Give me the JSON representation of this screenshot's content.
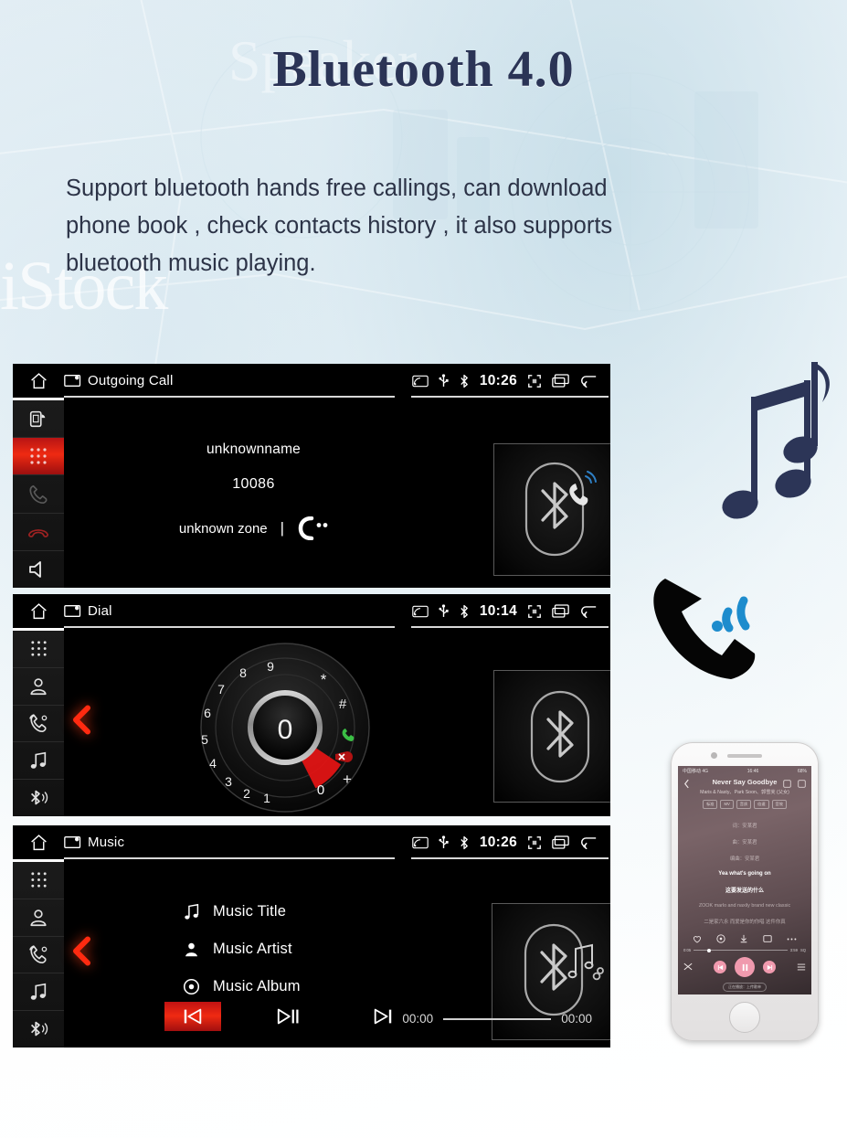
{
  "header": {
    "title": "Bluetooth 4.0",
    "subtitle_lines": [
      "Support bluetooth hands free callings, can download",
      "phone book , check contacts history , it also supports",
      "bluetooth music playing."
    ]
  },
  "background": {
    "watermark": "iStock",
    "watermark_2": "Speaker",
    "accent_blue": "#2b3456",
    "signal_blue": "#1b8fd0",
    "page_bg": "#f2f8fb"
  },
  "screens": [
    {
      "id": "outgoing-call",
      "statusbar": {
        "home_icon": "home-icon",
        "app_icon": "screen-cast-icon",
        "title": "Outgoing Call",
        "status_icons": [
          "cast-icon",
          "usb-icon",
          "bluetooth-icon"
        ],
        "time": "10:26",
        "nav_icons": [
          "fullscreen-icon",
          "recents-icon",
          "back-icon"
        ]
      },
      "sidebar": [
        {
          "name": "phone-signal-icon",
          "active": false
        },
        {
          "name": "keypad-icon",
          "active": true
        },
        {
          "name": "call-icon",
          "active": false
        },
        {
          "name": "hangup-icon",
          "active": false
        },
        {
          "name": "speaker-icon",
          "active": false
        }
      ],
      "call": {
        "name": "unknownname",
        "number": "10086",
        "zone": "unknown zone",
        "divider": "|",
        "status_icon": "calling-icon"
      },
      "art_icon": "bluetooth-call-icon"
    },
    {
      "id": "dial",
      "statusbar": {
        "home_icon": "home-icon",
        "app_icon": "screen-cast-icon",
        "title": "Dial",
        "status_icons": [
          "cast-icon",
          "usb-icon",
          "bluetooth-icon"
        ],
        "time": "10:14",
        "nav_icons": [
          "fullscreen-icon",
          "recents-icon",
          "back-icon"
        ]
      },
      "sidebar": [
        {
          "name": "keypad-icon",
          "active": false
        },
        {
          "name": "contacts-icon",
          "active": false
        },
        {
          "name": "call-history-icon",
          "active": false
        },
        {
          "name": "music-icon",
          "active": false
        },
        {
          "name": "bluetooth-icon",
          "active": false
        }
      ],
      "dialpad": {
        "center_display": "0",
        "outer_keys": [
          "1",
          "2",
          "3",
          "4",
          "5",
          "6",
          "7",
          "8",
          "9",
          "*",
          "#"
        ],
        "highlighted_key": "0",
        "extra_keys": [
          "+"
        ],
        "call_button": "green-call-icon",
        "delete_button": "red-delete-icon"
      },
      "art_icon": "bluetooth-icon",
      "back_chevron": "chevron-left-icon"
    },
    {
      "id": "music",
      "statusbar": {
        "home_icon": "home-icon",
        "app_icon": "screen-cast-icon",
        "title": "Music",
        "status_icons": [
          "cast-icon",
          "usb-icon",
          "bluetooth-icon"
        ],
        "time": "10:26",
        "nav_icons": [
          "fullscreen-icon",
          "recents-icon",
          "back-icon"
        ]
      },
      "sidebar": [
        {
          "name": "keypad-icon",
          "active": false
        },
        {
          "name": "contacts-icon",
          "active": false
        },
        {
          "name": "call-history-icon",
          "active": false
        },
        {
          "name": "music-icon",
          "active": false
        },
        {
          "name": "bluetooth-icon",
          "active": false
        }
      ],
      "track": [
        {
          "icon": "music-note-icon",
          "label": "Music Title"
        },
        {
          "icon": "artist-icon",
          "label": "Music Artist"
        },
        {
          "icon": "album-disc-icon",
          "label": "Music Album"
        }
      ],
      "controls": [
        {
          "name": "previous-button",
          "icon": "skip-back-icon",
          "active": true
        },
        {
          "name": "play-pause-button",
          "icon": "play-pause-icon",
          "active": false
        },
        {
          "name": "next-button",
          "icon": "skip-forward-icon",
          "active": false
        }
      ],
      "progress": {
        "elapsed": "00:00",
        "total": "00:00",
        "percent": 0
      },
      "art_icon": "bluetooth-music-icon",
      "back_chevron": "chevron-left-icon"
    }
  ],
  "decor": {
    "music_notes_icon": "music-notes-icon",
    "phone_call_icon": "phone-ringing-icon"
  },
  "phone_mock": {
    "status": {
      "carrier": "中国移动 4G",
      "time": "16:46",
      "battery": "68%"
    },
    "nav": {
      "back_icon": "chevron-left-icon",
      "cast_icon": "cast-icon",
      "share_icon": "share-icon"
    },
    "song_title": "Never Say Goodbye",
    "artist_line": "Maris & Nasty、Park Soon、郭雪芙 (父女)",
    "tags": [
      "标准",
      "MV",
      "音质",
      "倍速",
      "音效"
    ],
    "credits": [
      "词：安某君",
      "曲：安某君",
      "编曲：安某君"
    ],
    "lyrics_current": "Yea what's going on",
    "lyrics_sub": "这要发送的什么",
    "lyrics_next": "ZOOK marlo and naxily brand new classic",
    "lyrics_next2": "二是家六永 而爱是你的你唱 这件你真",
    "icon_row": [
      "heart-icon",
      "comment-icon",
      "download-icon",
      "share-icon",
      "more-icon"
    ],
    "seek": {
      "elapsed": "0:05",
      "total": "3:59",
      "quality": "SQ"
    },
    "play_row": [
      "shuffle-icon",
      "previous-icon",
      "pause-icon",
      "next-icon",
      "playlist-icon"
    ],
    "bottom_note": "正在播放：上传歌单"
  }
}
